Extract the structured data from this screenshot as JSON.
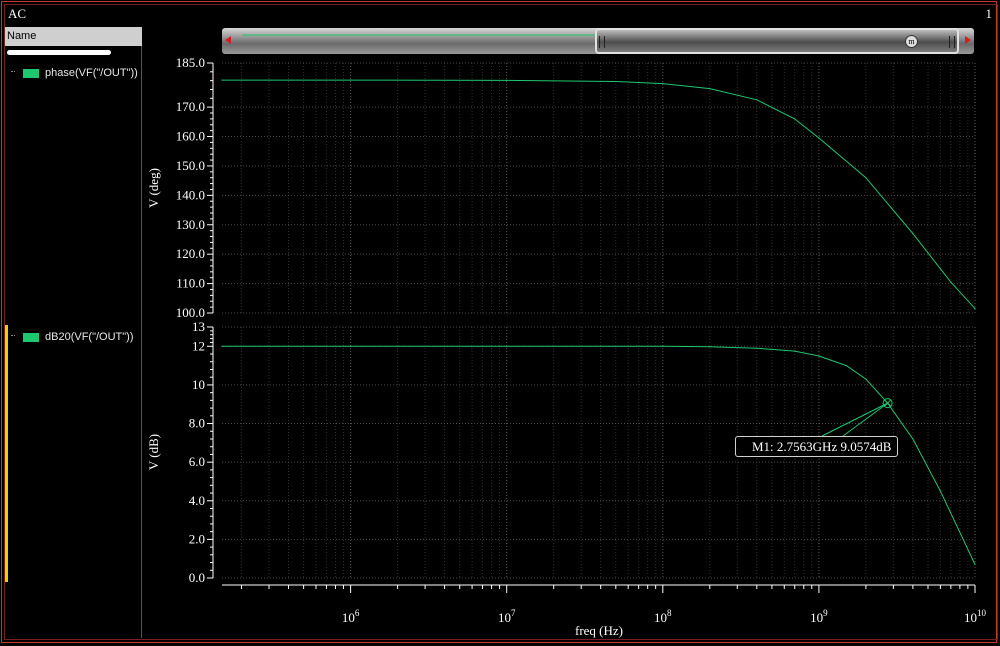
{
  "window": {
    "title": "AC",
    "number": "1"
  },
  "sidebar": {
    "header": "Name",
    "traces": [
      {
        "label": "phase(VF(\"/OUT\"))",
        "color": "#1ec86e"
      },
      {
        "label": "dB20(VF(\"/OUT\"))",
        "color": "#1ec86e"
      }
    ]
  },
  "scroller": {
    "marker_symbol": "m"
  },
  "marker": {
    "label": "M1: 2.7563GHz 9.0574dB"
  },
  "chart_data": [
    {
      "type": "line",
      "series": [
        {
          "name": "phase(VF(\"/OUT\"))",
          "color": "#1ec86e",
          "x": [
            150000,
            1000000,
            10000000,
            50000000,
            100000000,
            200000000,
            400000000,
            700000000,
            1000000000,
            2000000000,
            4000000000,
            7000000000,
            10000000000
          ],
          "y": [
            179.2,
            179.2,
            179.1,
            178.7,
            178.0,
            176.3,
            172.5,
            166.0,
            159.5,
            146.0,
            127.0,
            110.5,
            101.5
          ]
        }
      ],
      "xlabel": "",
      "ylabel": "V (deg)",
      "xscale": "log",
      "xlim": [
        150000,
        10000000000
      ],
      "ylim": [
        100.0,
        185.0
      ],
      "yticks": [
        "100.0",
        "110.0",
        "120.0",
        "130.0",
        "140.0",
        "150.0",
        "160.0",
        "170.0",
        "185.0"
      ],
      "ytick_values": [
        100,
        110,
        120,
        130,
        140,
        150,
        160,
        170,
        185
      ],
      "grid": true
    },
    {
      "type": "line",
      "series": [
        {
          "name": "dB20(VF(\"/OUT\"))",
          "color": "#1ec86e",
          "x": [
            150000,
            1000000,
            10000000,
            100000000,
            200000000,
            400000000,
            700000000,
            1000000000,
            1500000000,
            2000000000,
            2756300000,
            4000000000,
            6000000000,
            10000000000
          ],
          "y": [
            12.0,
            12.0,
            12.0,
            12.0,
            11.98,
            11.9,
            11.75,
            11.5,
            11.0,
            10.3,
            9.0574,
            7.2,
            4.5,
            0.7
          ]
        }
      ],
      "xlabel": "freq (Hz)",
      "ylabel": "V (dB)",
      "xscale": "log",
      "xlim": [
        150000,
        10000000000
      ],
      "ylim": [
        0.0,
        13.0
      ],
      "yticks": [
        "0.0",
        "2.0",
        "4.0",
        "6.0",
        "8.0",
        "10",
        "12",
        "13"
      ],
      "ytick_values": [
        0,
        2,
        4,
        6,
        8,
        10,
        12,
        13
      ],
      "xticks": [
        {
          "base": "10",
          "exp": "6",
          "value": 1000000
        },
        {
          "base": "10",
          "exp": "7",
          "value": 10000000
        },
        {
          "base": "10",
          "exp": "8",
          "value": 100000000
        },
        {
          "base": "10",
          "exp": "9",
          "value": 1000000000
        },
        {
          "base": "10",
          "exp": "10",
          "value": 10000000000
        }
      ],
      "marker": {
        "x": 2756300000,
        "y": 9.0574
      },
      "grid": true
    }
  ]
}
